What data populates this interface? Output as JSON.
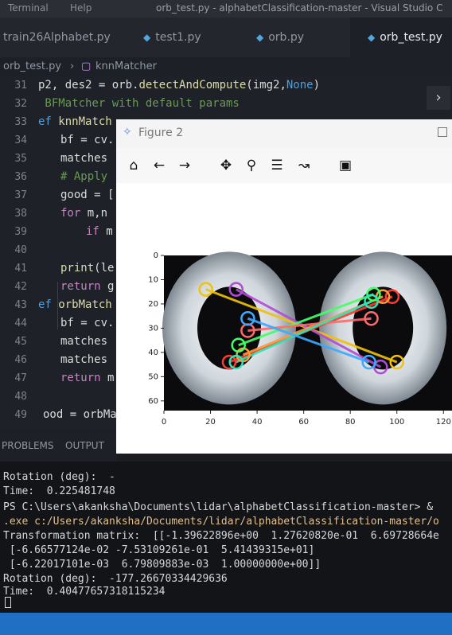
{
  "menubar": {
    "items": [
      "Terminal",
      "Help"
    ],
    "window_title": "orb_test.py - alphabetClassification-master - Visual Studio C"
  },
  "tabs": [
    {
      "label": "train26Alphabet.py",
      "icon": "python-icon",
      "active": false
    },
    {
      "label": "test1.py",
      "icon": "python-icon",
      "active": false
    },
    {
      "label": "orb.py",
      "icon": "python-icon",
      "active": false
    },
    {
      "label": "orb_test.py",
      "icon": "python-icon",
      "active": true
    }
  ],
  "breadcrumb": {
    "file": "orb_test.py",
    "symbol": "knnMatcher"
  },
  "editor": {
    "lines": [
      {
        "n": "31",
        "text": "p2, des2 = orb.detectAndCompute(img2,None)"
      },
      {
        "n": "32",
        "text": " BFMatcher with default params"
      },
      {
        "n": "33",
        "text": "ef knnMatch"
      },
      {
        "n": "34",
        "text": "bf = cv."
      },
      {
        "n": "35",
        "text": "matches"
      },
      {
        "n": "36",
        "text": "# Apply"
      },
      {
        "n": "37",
        "text": "good = ["
      },
      {
        "n": "38",
        "text": "for m,n"
      },
      {
        "n": "39",
        "text": "if m"
      },
      {
        "n": "40",
        "text": ""
      },
      {
        "n": "41",
        "text": "print(le"
      },
      {
        "n": "42",
        "text": "return g"
      },
      {
        "n": "43",
        "text": "ef orbMatch"
      },
      {
        "n": "44",
        "text": "bf = cv."
      },
      {
        "n": "45",
        "text": "matches"
      },
      {
        "n": "46",
        "text": "matches"
      },
      {
        "n": "47",
        "text": "return m"
      },
      {
        "n": "48",
        "text": ""
      },
      {
        "n": "49",
        "text": "ood = orbMa"
      }
    ]
  },
  "figure": {
    "title": "Figure 2",
    "toolbar": [
      "home-icon",
      "back-arrow-icon",
      "forward-arrow-icon",
      "pan-icon",
      "zoom-icon",
      "configure-subplots-icon",
      "edit-axes-icon",
      "save-icon"
    ]
  },
  "chart_data": {
    "type": "image",
    "x_ticks": [
      "0",
      "20",
      "40",
      "60",
      "80",
      "100",
      "120"
    ],
    "y_ticks": [
      "0",
      "10",
      "20",
      "30",
      "40",
      "50",
      "60"
    ],
    "xlim": [
      0,
      124
    ],
    "ylim": [
      64,
      0
    ],
    "keypoints_left": [
      {
        "x": 18,
        "y": 14,
        "color": "#f0c20a"
      },
      {
        "x": 31,
        "y": 14,
        "color": "#b24bd6"
      },
      {
        "x": 28,
        "y": 44,
        "color": "#ff3b30"
      },
      {
        "x": 34,
        "y": 41,
        "color": "#ff9a3c"
      },
      {
        "x": 32,
        "y": 37,
        "color": "#44ff66"
      },
      {
        "x": 36,
        "y": 31,
        "color": "#ff6b6b"
      },
      {
        "x": 31,
        "y": 44,
        "color": "#2ee6b8"
      },
      {
        "x": 36,
        "y": 26,
        "color": "#3fa9ff"
      }
    ],
    "keypoints_right": [
      {
        "x": 100,
        "y": 44,
        "color": "#f0c20a"
      },
      {
        "x": 93,
        "y": 46,
        "color": "#b24bd6"
      },
      {
        "x": 98,
        "y": 17,
        "color": "#ff3b30"
      },
      {
        "x": 94,
        "y": 17,
        "color": "#ff9a3c"
      },
      {
        "x": 90,
        "y": 16,
        "color": "#44ff66"
      },
      {
        "x": 89,
        "y": 26,
        "color": "#ff6b6b"
      },
      {
        "x": 89,
        "y": 19,
        "color": "#2ee6b8"
      },
      {
        "x": 88,
        "y": 44,
        "color": "#3fa9ff"
      }
    ]
  },
  "panel": {
    "tabs": [
      "PROBLEMS",
      "OUTPUT"
    ]
  },
  "terminal": {
    "lines": [
      "Rotation (deg):  -",
      "Time:  0.225481748",
      "PS C:\\Users\\akanksha\\Documents\\lidar\\alphabetClassification-master> &",
      ".exe c:/Users/akanksha/Documents/lidar/alphabetClassification-master/o",
      "Transformation matrix:  [[-1.39622896e+00  1.27620820e-01  6.69728664e",
      " [-6.66577124e-02 -7.53109261e-01  5.41439315e+01]",
      " [-6.22017101e-03  6.79809883e-03  1.00000000e+00]]",
      "Rotation (deg):  -177.26670334429636",
      "Time:  0.40477657318115234"
    ]
  },
  "colors": {
    "accent": "#1f6fc5",
    "keyword": "#569cd6",
    "comment": "#6a9955"
  }
}
